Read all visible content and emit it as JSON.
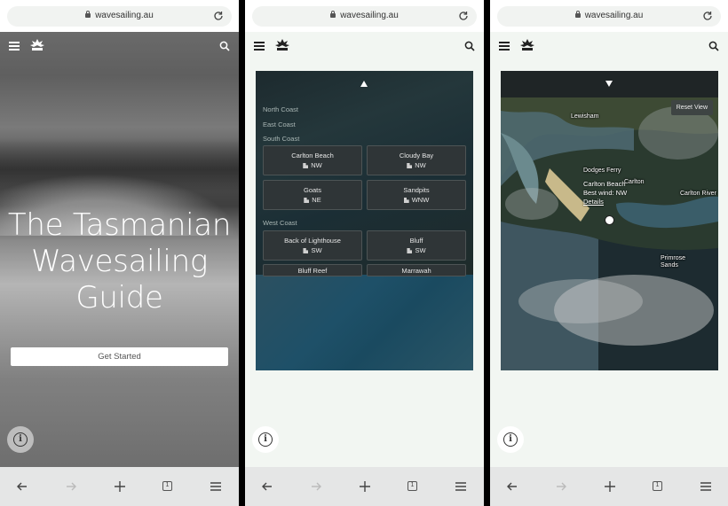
{
  "browser": {
    "url": "wavesailing.au",
    "tab_count": "1"
  },
  "hero": {
    "title_lines": [
      "The Tasmanian",
      "Wavesailing",
      "Guide"
    ],
    "cta": "Get Started"
  },
  "locations": {
    "regions": [
      "North Coast",
      "East Coast",
      "South Coast",
      "West Coast"
    ],
    "south_coast": [
      {
        "name": "Carlton Beach",
        "wind": "NW"
      },
      {
        "name": "Cloudy Bay",
        "wind": "NW"
      },
      {
        "name": "Goats",
        "wind": "NE"
      },
      {
        "name": "Sandpits",
        "wind": "WNW"
      }
    ],
    "west_coast": [
      {
        "name": "Back of Lighthouse",
        "wind": "SW"
      },
      {
        "name": "Bluff",
        "wind": "SW"
      },
      {
        "name": "Bluff Reef",
        "wind": ""
      },
      {
        "name": "Marrawah",
        "wind": ""
      }
    ]
  },
  "map": {
    "reset_label": "Reset View",
    "place_labels": [
      "Lewisham",
      "Dodges Ferry",
      "Carlton",
      "Carlton River",
      "Primrose Sands"
    ],
    "popup": {
      "name": "Carlton Beach",
      "wind": "Best wind: NW",
      "details": "Details"
    }
  },
  "colors": {
    "page_bg": "#f2f6f2",
    "bottom_bar": "#e5e6e6",
    "tile_bg": "#2f3537"
  }
}
